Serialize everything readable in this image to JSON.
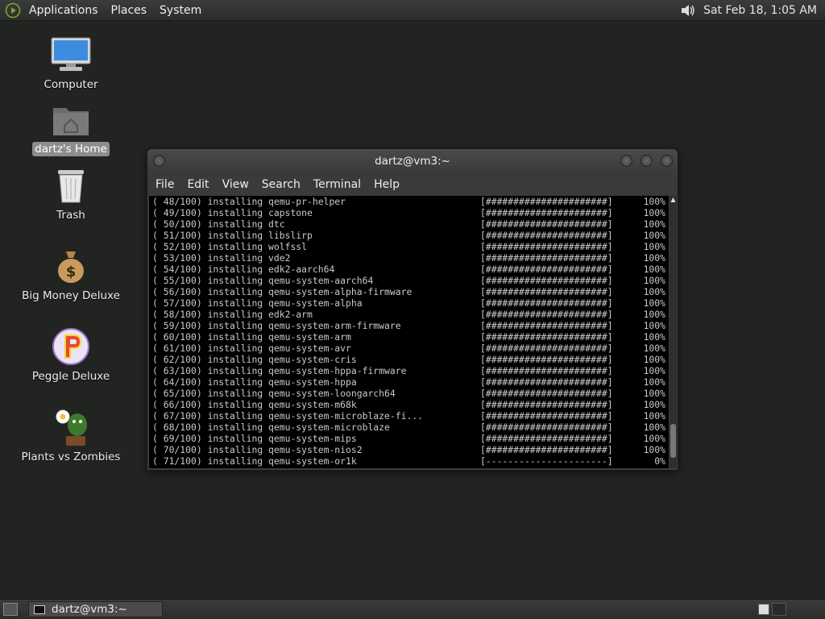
{
  "top_panel": {
    "menus": [
      "Applications",
      "Places",
      "System"
    ],
    "clock": "Sat Feb 18,  1:05 AM"
  },
  "desktop": {
    "icons": [
      {
        "label": "Computer",
        "icon": "computer-icon"
      },
      {
        "label": "dartz's Home",
        "icon": "home-folder-icon"
      },
      {
        "label": "Trash",
        "icon": "trash-icon"
      },
      {
        "label": "Big Money Deluxe",
        "icon": "money-bag-icon"
      },
      {
        "label": "Peggle Deluxe",
        "icon": "peggle-icon"
      },
      {
        "label": "Plants vs Zombies",
        "icon": "plants-vs-zombies-icon"
      }
    ]
  },
  "terminal": {
    "title": "dartz@vm3:~",
    "menu": [
      "File",
      "Edit",
      "View",
      "Search",
      "Terminal",
      "Help"
    ],
    "lines": [
      {
        "left": "( 48/100) installing qemu-pr-helper",
        "bar": "[######################]",
        "pct": "100%"
      },
      {
        "left": "( 49/100) installing capstone",
        "bar": "[######################]",
        "pct": "100%"
      },
      {
        "left": "( 50/100) installing dtc",
        "bar": "[######################]",
        "pct": "100%"
      },
      {
        "left": "( 51/100) installing libslirp",
        "bar": "[######################]",
        "pct": "100%"
      },
      {
        "left": "( 52/100) installing wolfssl",
        "bar": "[######################]",
        "pct": "100%"
      },
      {
        "left": "( 53/100) installing vde2",
        "bar": "[######################]",
        "pct": "100%"
      },
      {
        "left": "( 54/100) installing edk2-aarch64",
        "bar": "[######################]",
        "pct": "100%"
      },
      {
        "left": "( 55/100) installing qemu-system-aarch64",
        "bar": "[######################]",
        "pct": "100%"
      },
      {
        "left": "( 56/100) installing qemu-system-alpha-firmware",
        "bar": "[######################]",
        "pct": "100%"
      },
      {
        "left": "( 57/100) installing qemu-system-alpha",
        "bar": "[######################]",
        "pct": "100%"
      },
      {
        "left": "( 58/100) installing edk2-arm",
        "bar": "[######################]",
        "pct": "100%"
      },
      {
        "left": "( 59/100) installing qemu-system-arm-firmware",
        "bar": "[######################]",
        "pct": "100%"
      },
      {
        "left": "( 60/100) installing qemu-system-arm",
        "bar": "[######################]",
        "pct": "100%"
      },
      {
        "left": "( 61/100) installing qemu-system-avr",
        "bar": "[######################]",
        "pct": "100%"
      },
      {
        "left": "( 62/100) installing qemu-system-cris",
        "bar": "[######################]",
        "pct": "100%"
      },
      {
        "left": "( 63/100) installing qemu-system-hppa-firmware",
        "bar": "[######################]",
        "pct": "100%"
      },
      {
        "left": "( 64/100) installing qemu-system-hppa",
        "bar": "[######################]",
        "pct": "100%"
      },
      {
        "left": "( 65/100) installing qemu-system-loongarch64",
        "bar": "[######################]",
        "pct": "100%"
      },
      {
        "left": "( 66/100) installing qemu-system-m68k",
        "bar": "[######################]",
        "pct": "100%"
      },
      {
        "left": "( 67/100) installing qemu-system-microblaze-fi...",
        "bar": "[######################]",
        "pct": "100%"
      },
      {
        "left": "( 68/100) installing qemu-system-microblaze",
        "bar": "[######################]",
        "pct": "100%"
      },
      {
        "left": "( 69/100) installing qemu-system-mips",
        "bar": "[######################]",
        "pct": "100%"
      },
      {
        "left": "( 70/100) installing qemu-system-nios2",
        "bar": "[######################]",
        "pct": "100%"
      },
      {
        "left": "( 71/100) installing qemu-system-or1k",
        "bar": "[----------------------]",
        "pct": "0%"
      }
    ]
  },
  "bottom_panel": {
    "task_label": "dartz@vm3:~"
  }
}
